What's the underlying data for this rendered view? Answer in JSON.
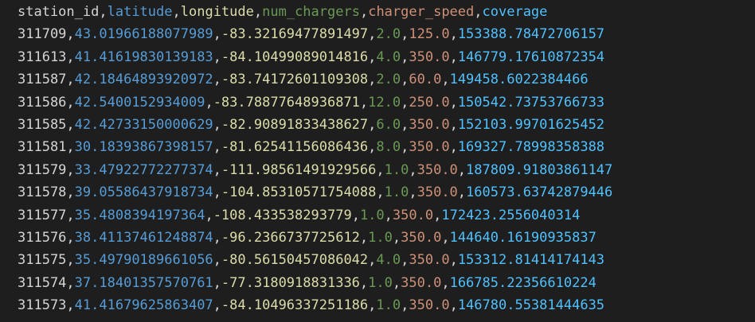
{
  "colors": {
    "background": "#1e1e1e",
    "col_station_id": "#d4d4d4",
    "col_latitude": "#569cd6",
    "col_longitude": "#dcdcaa",
    "col_num_chargers": "#6a9955",
    "col_charger_speed": "#ce9178",
    "col_coverage": "#4fc1ff"
  },
  "csv": {
    "header": [
      "station_id",
      "latitude",
      "longitude",
      "num_chargers",
      "charger_speed",
      "coverage"
    ],
    "rows": [
      [
        "311709",
        "43.01966188077989",
        "-83.32169477891497",
        "2.0",
        "125.0",
        "153388.78472706157"
      ],
      [
        "311613",
        "41.41619830139183",
        "-84.10499089014816",
        "4.0",
        "350.0",
        "146779.17610872354"
      ],
      [
        "311587",
        "42.18464893920972",
        "-83.74172601109308",
        "2.0",
        "60.0",
        "149458.6022384466"
      ],
      [
        "311586",
        "42.5400152934009",
        "-83.78877648936871",
        "12.0",
        "250.0",
        "150542.73753766733"
      ],
      [
        "311585",
        "42.42733150000629",
        "-82.90891833438627",
        "6.0",
        "350.0",
        "152103.99701625452"
      ],
      [
        "311581",
        "30.18393867398157",
        "-81.62541156086436",
        "8.0",
        "350.0",
        "169327.78998358388"
      ],
      [
        "311579",
        "33.47922772277374",
        "-111.98561491929566",
        "1.0",
        "350.0",
        "187809.91803861147"
      ],
      [
        "311578",
        "39.05586437918734",
        "-104.85310571754088",
        "1.0",
        "350.0",
        "160573.63742879446"
      ],
      [
        "311577",
        "35.4808394197364",
        "-108.433538293779",
        "1.0",
        "350.0",
        "172423.2556040314"
      ],
      [
        "311576",
        "38.41137461248874",
        "-96.2366737725612",
        "1.0",
        "350.0",
        "144640.16190935837"
      ],
      [
        "311575",
        "35.49790189661056",
        "-80.56150457086042",
        "4.0",
        "350.0",
        "153312.81414174143"
      ],
      [
        "311574",
        "37.18401357570761",
        "-77.3180918831336",
        "1.0",
        "350.0",
        "166785.22356610224"
      ],
      [
        "311573",
        "41.41679625863407",
        "-84.10496337251186",
        "1.0",
        "350.0",
        "146780.55381444635"
      ]
    ]
  }
}
